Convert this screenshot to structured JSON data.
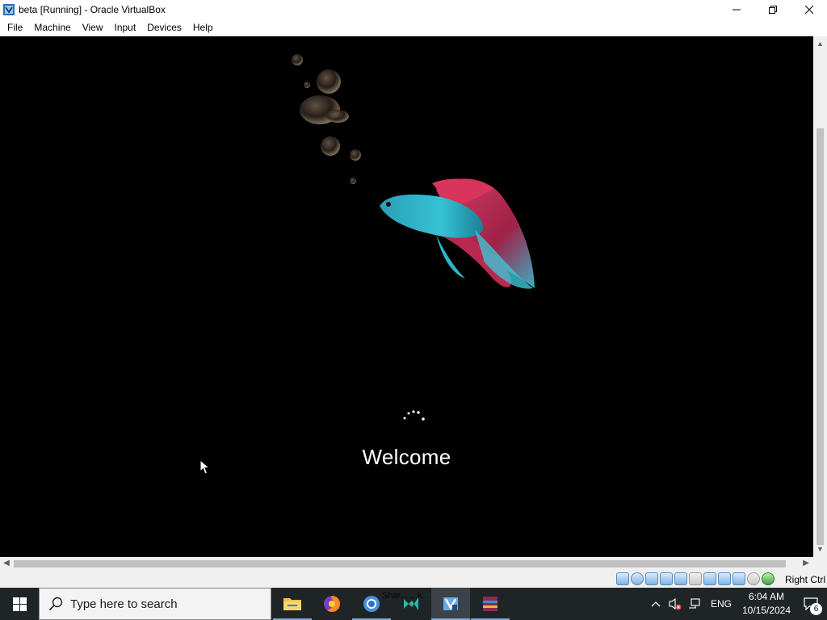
{
  "window": {
    "title": "beta [Running] - Oracle VirtualBox"
  },
  "menu": {
    "items": [
      "File",
      "Machine",
      "View",
      "Input",
      "Devices",
      "Help"
    ]
  },
  "vm": {
    "welcome_text": "Welcome",
    "background_color": "#000000",
    "fish_colors": [
      "#2fb3c6",
      "#d9345b"
    ]
  },
  "statusbar": {
    "icons": [
      "hard-disk-icon",
      "optical-drive-icon",
      "audio-icon",
      "network-icon",
      "usb-icon",
      "shared-folders-icon",
      "display-icon",
      "video-capture-icon",
      "mouse-integration-icon",
      "keyboard-icon",
      "host-key-icon"
    ],
    "host_key_label": "Right Ctrl"
  },
  "taskbar": {
    "search_placeholder": "Type here to search",
    "apps": [
      "file-explorer",
      "firefox",
      "chrome",
      "visual-studio",
      "virtualbox",
      "winrar"
    ],
    "tooltip_fragment": "Shar... ...k..",
    "language": "ENG",
    "time": "6:04 AM",
    "date": "10/15/2024",
    "notification_count": "6"
  }
}
